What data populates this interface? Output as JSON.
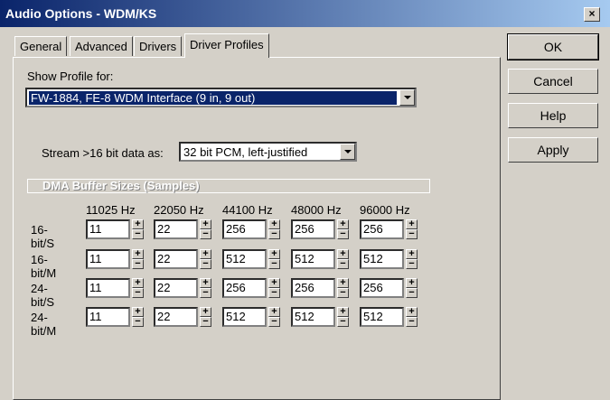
{
  "window": {
    "title": "Audio Options - WDM/KS",
    "close_glyph": "×"
  },
  "tabs": [
    "General",
    "Advanced",
    "Drivers",
    "Driver Profiles"
  ],
  "profile": {
    "label": "Show Profile for:",
    "value": "FW-1884, FE-8 WDM Interface (9 in, 9 out)"
  },
  "stream": {
    "label": "Stream >16 bit data as:",
    "value": "32 bit PCM, left-justified"
  },
  "dma": {
    "title": "DMA Buffer Sizes (Samples)",
    "columns": [
      "11025 Hz",
      "22050 Hz",
      "44100 Hz",
      "48000 Hz",
      "96000 Hz"
    ],
    "rows": [
      {
        "label": "16-bit/S",
        "values": [
          "11",
          "22",
          "256",
          "256",
          "256"
        ]
      },
      {
        "label": "16-bit/M",
        "values": [
          "11",
          "22",
          "512",
          "512",
          "512"
        ]
      },
      {
        "label": "24-bit/S",
        "values": [
          "11",
          "22",
          "256",
          "256",
          "256"
        ]
      },
      {
        "label": "24-bit/M",
        "values": [
          "11",
          "22",
          "512",
          "512",
          "512"
        ]
      }
    ]
  },
  "spin_glyphs": {
    "up": "+",
    "down": "−"
  },
  "buttons": {
    "ok": "OK",
    "cancel": "Cancel",
    "help": "Help",
    "apply": "Apply"
  }
}
